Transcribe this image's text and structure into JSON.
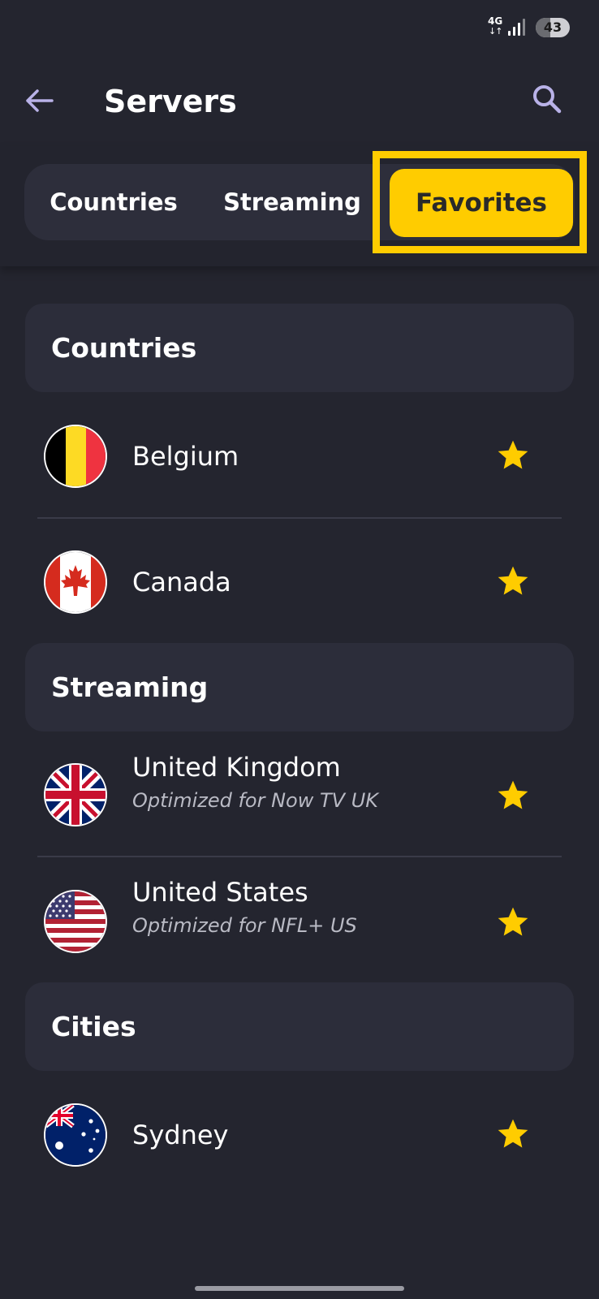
{
  "status_bar": {
    "network": "4G",
    "battery": "43",
    "battery_level": 0.43
  },
  "header": {
    "title": "Servers",
    "back_icon": "arrow-left-icon",
    "search_icon": "search-icon"
  },
  "tabs": {
    "items": [
      {
        "label": "Countries"
      },
      {
        "label": "Streaming"
      },
      {
        "label": "Favorites"
      }
    ],
    "selected": "Favorites"
  },
  "colors": {
    "accent": "#ffcc00",
    "background": "#24252f",
    "section_bg": "#2c2d3a"
  },
  "sections": [
    {
      "title": "Countries",
      "items": [
        {
          "name": "Belgium",
          "flag": "belgium-flag",
          "favorite": true
        },
        {
          "name": "Canada",
          "flag": "canada-flag",
          "favorite": true
        }
      ]
    },
    {
      "title": "Streaming",
      "items": [
        {
          "name": "United Kingdom",
          "subtitle": "Optimized for Now TV UK",
          "flag": "uk-flag",
          "favorite": true
        },
        {
          "name": "United States",
          "subtitle": "Optimized for NFL+ US",
          "flag": "us-flag",
          "favorite": true
        }
      ]
    },
    {
      "title": "Cities",
      "items": [
        {
          "name": "Sydney",
          "flag": "australia-flag",
          "favorite": true
        }
      ]
    }
  ]
}
